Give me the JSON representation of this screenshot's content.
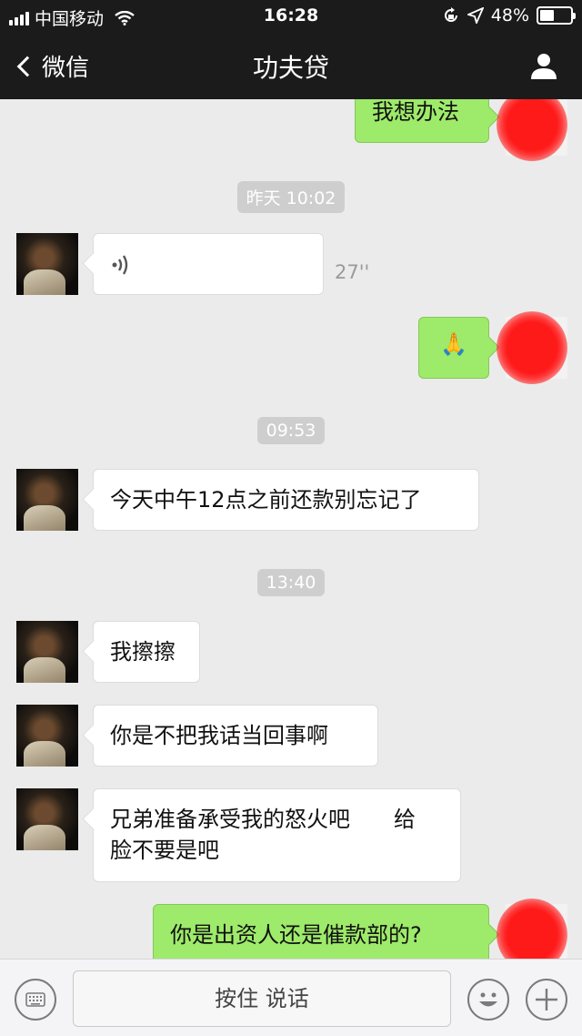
{
  "status_bar": {
    "carrier": "中国移动",
    "time": "16:28",
    "battery": "48%",
    "battery_level": 0.48
  },
  "nav": {
    "back_label": "微信",
    "title": "功夫贷"
  },
  "chat": {
    "partial_out_1": "我想办法",
    "ts_1": "昨天 10:02",
    "voice_duration": "27''",
    "emoji_msg": "🙏",
    "ts_2": "09:53",
    "msg_1": "今天中午12点之前还款别忘记了",
    "ts_3": "13:40",
    "msg_2": "我擦擦",
    "msg_3": "你是不把我话当回事啊",
    "msg_4_line1": "兄弟准备承受我的怒火吧　　给",
    "msg_4_line2": "脸不要是吧",
    "out_2": "你是出资人还是催款部的?"
  },
  "input_bar": {
    "hold_to_talk": "按住 说话"
  },
  "icons": [
    "signal-icon",
    "wifi-icon",
    "lock-rotation-icon",
    "location-icon",
    "battery-icon",
    "back-chevron-icon",
    "person-icon",
    "voice-wave-icon",
    "keyboard-icon",
    "emoji-icon",
    "plus-icon"
  ],
  "colors": {
    "nav_bg": "#1b1b1b",
    "chat_bg": "#ebebeb",
    "out_bubble": "#9eea6a",
    "in_bubble": "#ffffff",
    "timestamp_bg": "#cecece"
  }
}
